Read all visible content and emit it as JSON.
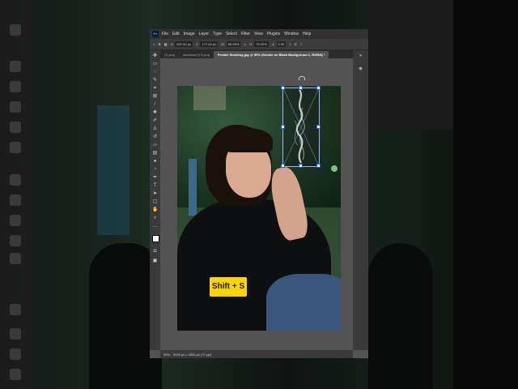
{
  "app": {
    "logo": "Ps",
    "menu": [
      "File",
      "Edit",
      "Image",
      "Layer",
      "Type",
      "Select",
      "Filter",
      "View",
      "Plugins",
      "Window",
      "Help"
    ]
  },
  "options_bar": {
    "x_label": "X:",
    "x_value": "837.00 px",
    "y_label": "Y:",
    "y_value": "177.00 px",
    "w_label": "W:",
    "w_value": "65.59%",
    "h_label": "H:",
    "h_value": "75.29%",
    "angle_value": "0.00"
  },
  "tabs": [
    {
      "label": "(2).png",
      "active": false
    },
    {
      "label": "download (17).png",
      "active": false
    },
    {
      "label": "Female Smoking.jpg @ 50% (Smoke on Black Background 1, RGB/8) *",
      "active": true
    }
  ],
  "status": {
    "zoom": "50%",
    "doc_size": "3000 px x 4500 px (72 ppi)"
  },
  "overlay": {
    "shortcut_badge": "Shift + S"
  },
  "colors": {
    "badge_bg": "#ffd400",
    "selection_border": "#9fb4ff",
    "handle_border": "#1a5aff"
  }
}
